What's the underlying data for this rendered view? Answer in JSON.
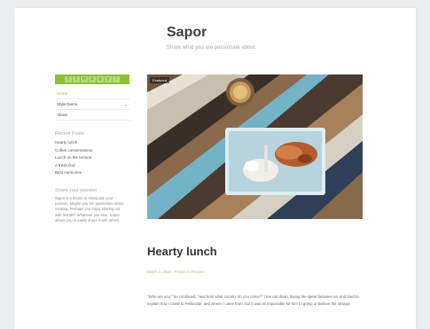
{
  "site": {
    "title": "Sapor",
    "description": "Share what you are passionate about."
  },
  "social_icons": [
    "f",
    "t",
    "in",
    "p",
    "g",
    "y",
    "i"
  ],
  "nav": [
    {
      "label": "Home",
      "active": true
    },
    {
      "label": "Style Demo",
      "active": false,
      "has_submenu": true
    },
    {
      "label": "About",
      "active": false
    }
  ],
  "nav_chevron": "⌄",
  "widgets": {
    "recent_posts_title": "Recent Posts",
    "recent_posts": [
      "Hearty lunch",
      "Coffee conversations",
      "Lunch on the terrace",
      "A fresh find",
      "Best memories"
    ],
    "passion_title": "Share your passion",
    "passion_text": "Sapor is a theme to showcase your passion. Maybe you are passionate about cooking. Perhaps you enjoy sharing out with friends? Whatever you love, Sapor allows you to easily share it with others."
  },
  "featured_badge": "Featured",
  "post": {
    "title": "Hearty lunch",
    "meta": "March 3, 2015 · Posted in Recipes",
    "body": "\"Who are you,\" he continued, \"and from what country do you come?\" I tee out down, laying the spear between us, and tried to explain how I came to Pellucidar, and where I came from, but it was as impossible for him to grasp or believe the strange"
  },
  "colors": {
    "accent": "#8dbf3c",
    "page_bg": "#eceeef",
    "card_bg": "#ffffff"
  }
}
